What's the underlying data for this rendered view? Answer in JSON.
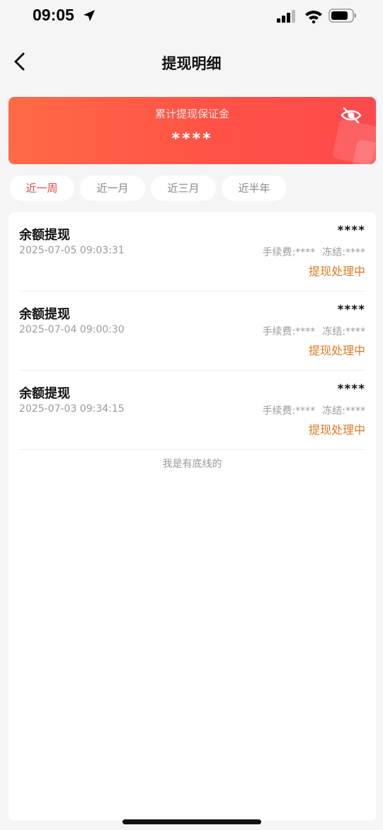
{
  "status_bar": {
    "time": "09:05"
  },
  "nav": {
    "title": "提现明细"
  },
  "summary": {
    "label": "累计提现保证金",
    "value": "****"
  },
  "tabs": [
    {
      "label": "近一周",
      "active": true
    },
    {
      "label": "近一月",
      "active": false
    },
    {
      "label": "近三月",
      "active": false
    },
    {
      "label": "近半年",
      "active": false
    }
  ],
  "records": [
    {
      "title": "余额提现",
      "time": "2025-07-05 09:03:31",
      "amount": "****",
      "fee": "手续费:****",
      "frozen": "冻结:****",
      "status": "提现处理中"
    },
    {
      "title": "余额提现",
      "time": "2025-07-04 09:00:30",
      "amount": "****",
      "fee": "手续费:****",
      "frozen": "冻结:****",
      "status": "提现处理中"
    },
    {
      "title": "余额提现",
      "time": "2025-07-03 09:34:15",
      "amount": "****",
      "fee": "手续费:****",
      "frozen": "冻结:****",
      "status": "提现处理中"
    }
  ],
  "footer": {
    "text": "我是有底线的"
  },
  "colors": {
    "accent": "#ff5a46",
    "status": "#e07a22",
    "active_tab": "#e8473e"
  },
  "icons": {
    "back": "chevron-left-icon",
    "toggle_visibility": "eye-off-icon"
  }
}
